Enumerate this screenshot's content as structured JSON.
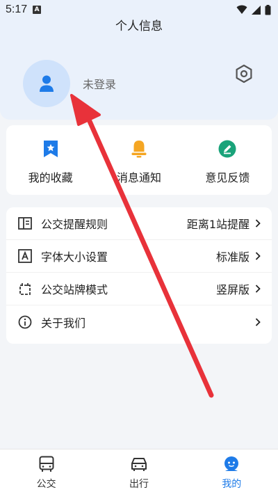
{
  "status_bar": {
    "time": "5:17",
    "notification_badge": "A"
  },
  "header": {
    "title": "个人信息"
  },
  "profile": {
    "login_text": "未登录",
    "avatar_icon": "user-icon",
    "settings_icon": "gear-icon"
  },
  "quick_actions": [
    {
      "label": "我的收藏",
      "icon": "bookmark-star-icon",
      "color": "#1e7be8"
    },
    {
      "label": "消息通知",
      "icon": "bell-icon",
      "color": "#f5a623"
    },
    {
      "label": "意见反馈",
      "icon": "edit-icon",
      "color": "#1aa37a"
    }
  ],
  "settings_list": [
    {
      "label": "公交提醒规则",
      "value": "距离1站提醒",
      "icon": "book-icon"
    },
    {
      "label": "字体大小设置",
      "value": "标准版",
      "icon": "font-size-icon"
    },
    {
      "label": "公交站牌模式",
      "value": "竖屏版",
      "icon": "calendar-icon"
    },
    {
      "label": "关于我们",
      "value": "",
      "icon": "info-icon"
    }
  ],
  "tabbar": [
    {
      "label": "公交",
      "icon": "bus-icon",
      "active": false
    },
    {
      "label": "出行",
      "icon": "car-icon",
      "active": false
    },
    {
      "label": "我的",
      "icon": "profile-face-icon",
      "active": true
    }
  ],
  "colors": {
    "accent": "#1e7be8",
    "annotation_arrow": "#e8323a"
  }
}
